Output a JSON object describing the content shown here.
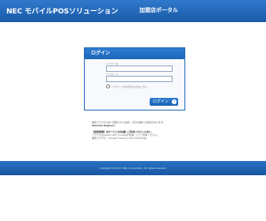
{
  "header": {
    "title": "NEC モバイルPOSソリューション",
    "subtitle": "加盟店ポータル"
  },
  "login": {
    "heading": "ログイン",
    "user_id_label": "ユーザーID",
    "user_id_placeholder": "",
    "password_label": "パスワード",
    "password_placeholder": "",
    "remember_label": "パスワードをお忘れの方はこちら",
    "button_label": "ログイン",
    "button_icon": "arrow-right-icon"
  },
  "notice": {
    "lines": [
      "推奨ブラウザ以外で閲覧される場合、表示が崩れる場合があります。",
      "Internet Explorer",
      "",
      "【推奨環境】本サービスを快適にご利用いただくために、",
      "ブラウザのJavaScriptとCookieを有効にしてご利用ください。",
      "推奨ブラウザ：Google Chrome / Microsoft Edge"
    ]
  },
  "footer": {
    "copyright": "Copyright (C) 2017 NEC Corporation. All rights reserved."
  },
  "colors": {
    "header": "#1d66b8",
    "panel_border": "#1d66b8",
    "footer": "#1856a2"
  }
}
